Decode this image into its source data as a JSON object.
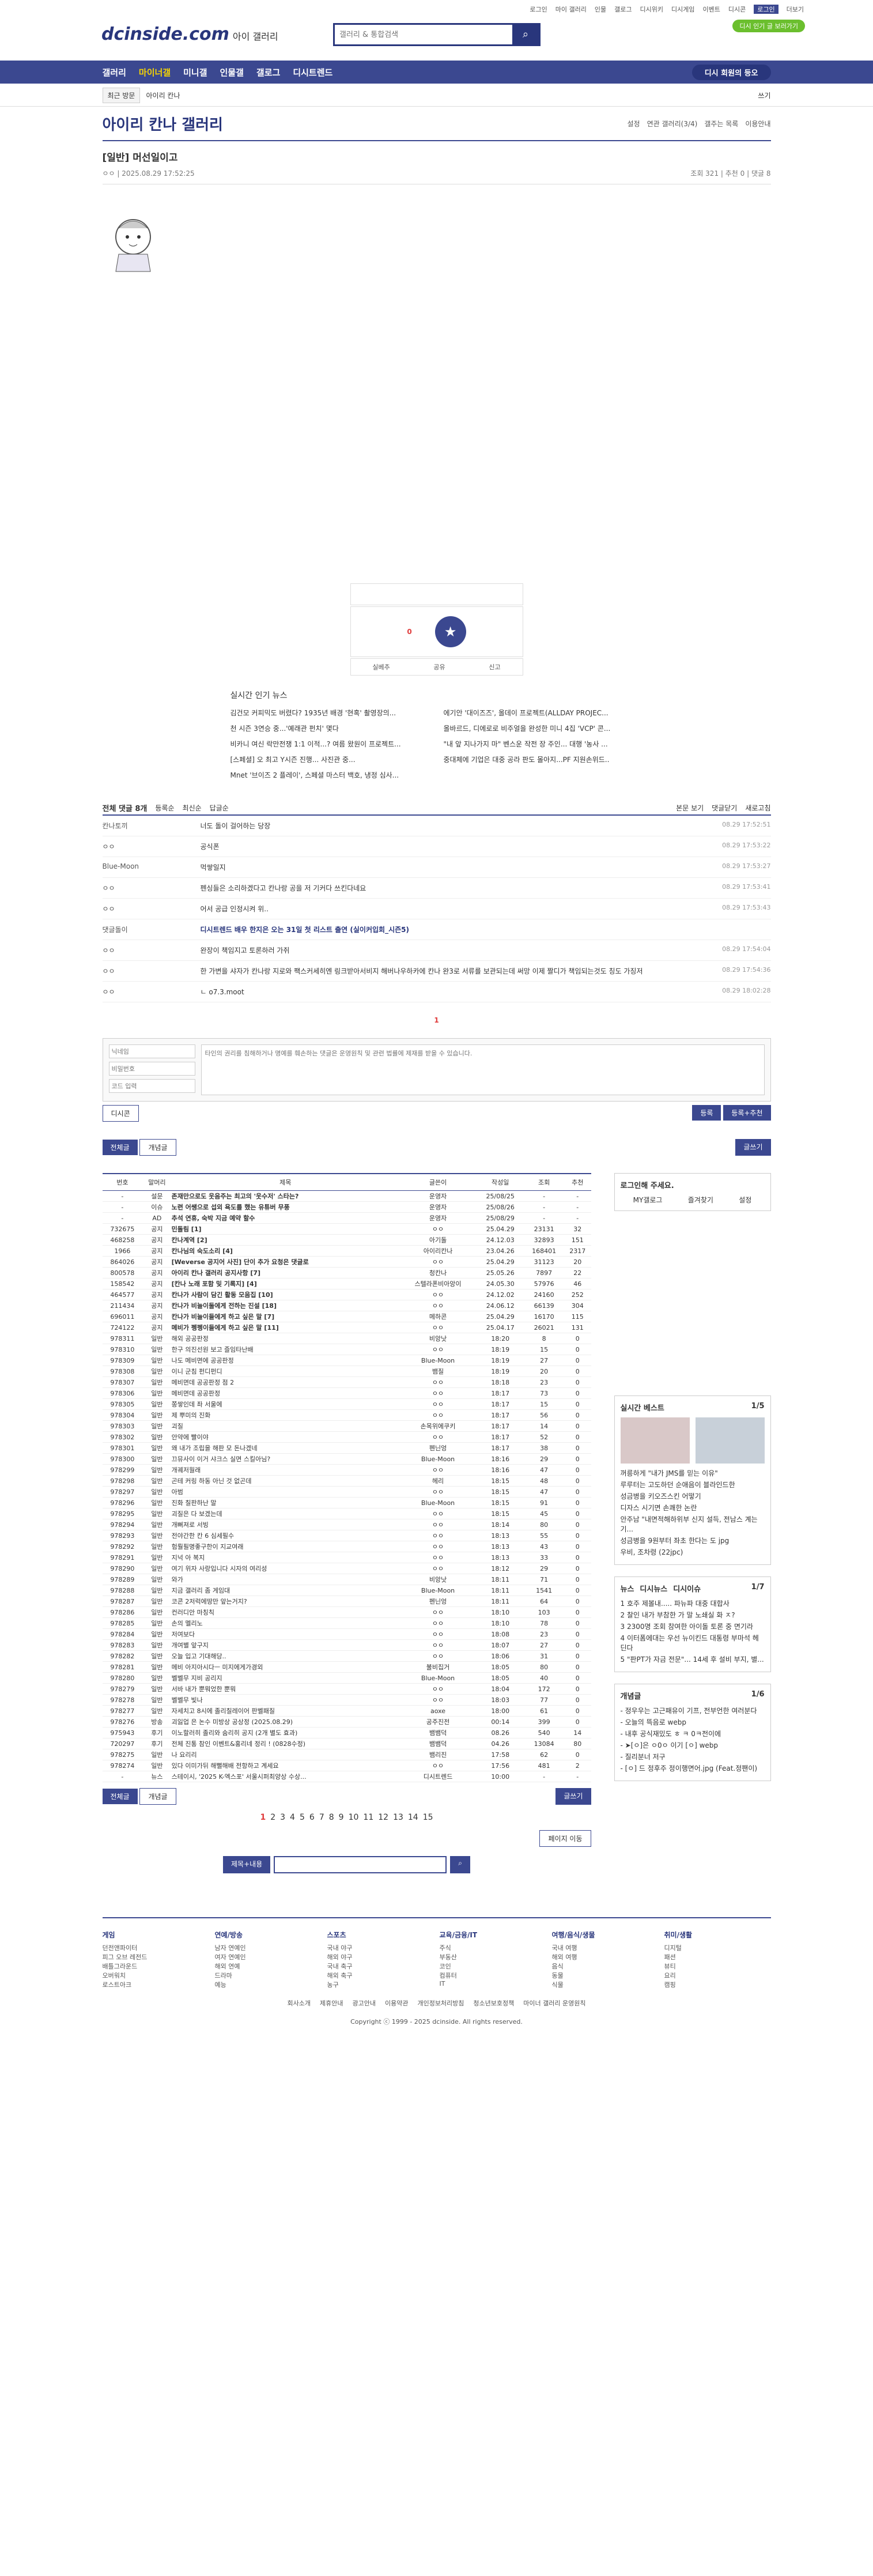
{
  "top": {
    "links": [
      "로그인",
      "마이 갤러리",
      "인물",
      "갤로그",
      "디시위키",
      "디시게임",
      "이벤트",
      "디시콘",
      "로그인",
      "더보기"
    ],
    "logo": "dcinside.com",
    "logo_sub": "아이 갤러리",
    "search_placeholder": "갤러리 & 통합검색",
    "green": "디시 인기 글 보러가기"
  },
  "gnb": {
    "items": [
      "갤러리",
      "마이너갤",
      "미니갤",
      "인물갤",
      "갤로그",
      "디시트렌드"
    ],
    "right": "디시 회원의 등오"
  },
  "subnav": {
    "chips": [
      "최근 방문",
      "아이리 칸나"
    ],
    "right": "쓰기"
  },
  "gallery": {
    "title": "아이리 칸나 갤러리",
    "opts": [
      "설정",
      "연관 갤러리(3/4)",
      "갤주는 목록",
      "이용안내"
    ]
  },
  "post": {
    "title": "[일반] 머선일이고",
    "author": "ㅇㅇ",
    "date": "2025.08.29 17:52:25",
    "views": "조회 321",
    "rec": "추천 0",
    "cmt": "댓글 8"
  },
  "rec": {
    "up": "0",
    "btn1": "실베추",
    "btn2": "공유",
    "btn3": "신고"
  },
  "news": {
    "title": "실시간 인기 뉴스",
    "items": [
      "김건모 커피믹도 버렸다? 1935년 배경 '현혹' 촬영장의...",
      "에기안 '대이즈즈', 올데이 프로젝트(ALLDAY PROJEC...",
      "천 시즌 3연승 중...'예래관 펀치' 몇다",
      "올바르드, 디에로로 비주얼을 완성한 미니 4집 'VCP' 콘...",
      "비카니 여신 락만전쟁 1:1 이적...? 여름 왔원이 프로젝트...",
      "\"내 앞 지나가지 마\" 벤스운 작전 장 주인... 대행 '농사 ...",
      "[스페셜] 오 최고 Y시즌 진행... 사진관 중...",
      "중대체에 기업은 대중 공라 판도 몰아지...PF 지원손위드..",
      "Mnet '브이즈 2 플레이', 스페셜 마스터 백호, 냉정 심사..."
    ]
  },
  "comments": {
    "head": "전체 댓글 8개",
    "opts": [
      "등록순",
      "최신순",
      "답글순"
    ],
    "right": [
      "본문 보기",
      "댓글닫기",
      "새로고침"
    ],
    "rows": [
      {
        "who": "칸나토끼",
        "txt": "너도 돌이 걸어하는 당장",
        "dt": "08.29 17:52:51"
      },
      {
        "who": "ㅇㅇ",
        "txt": "공식폰",
        "dt": "08.29 17:53:22"
      },
      {
        "who": "Blue-Moon",
        "txt": "먹쌓일지",
        "dt": "08.29 17:53:27"
      },
      {
        "who": "ㅇㅇ",
        "txt": "펜싱들은 소리하겠다고 칸나랑 공을 저 기커다 쓰킨다네요",
        "dt": "08.29 17:53:41"
      },
      {
        "who": "ㅇㅇ",
        "txt": "어서 공급 인정시켜 위..",
        "dt": "08.29 17:53:43"
      },
      {
        "who": "댓글돌이",
        "txt": "디시트렌드 배우 한지은 오는 31일 첫 리스트 출연 (실이커입회_시즌5)",
        "dt": ""
      },
      {
        "who": "ㅇㅇ",
        "txt": "완장이 책임지고 토론하러 가쥐",
        "dt": "08.29 17:54:04"
      },
      {
        "who": "ㅇㅇ",
        "txt": "한 가변을 샤자가 칸나랑 지로와 팩스커세히엔 링크받아서비지 해버나우하카에 칸나 완3로 서류를 보관되는데 써망 이제 짤디가 책임되는것도 칭도 가징저",
        "dt": "08.29 17:54:36"
      },
      {
        "who": "ㅇㅇ",
        "txt": "ㄴ o7.3.moot",
        "dt": "08.29 18:02:28"
      }
    ]
  },
  "pager1": "1",
  "form": {
    "name": "닉네임",
    "pw": "비밀번호",
    "captcha": "코드 입력",
    "placeholder": "타인의 권리를 침해하거나 명예를 훼손하는 댓글은 운영원칙 및 관련 법률에 제재를 받을 수 있습니다.",
    "btn1": "등록",
    "btn2": "등록+추천",
    "dc": "디시콘"
  },
  "tabs": {
    "all": "전체글",
    "best": "개념글",
    "write": "글쓰기"
  },
  "list": {
    "heads": [
      "번호",
      "말머리",
      "제목",
      "글쓴이",
      "작성일",
      "조회",
      "추천"
    ],
    "rows": [
      [
        "-",
        "설문",
        "존재만으로도 웃음주는 최고의 '웃수저' 스타는?",
        "운영자",
        "25/08/25",
        "-",
        "-"
      ],
      [
        "-",
        "이슈",
        "노련 어쌩으로 섭외 욕도를 했는 유튜버 무풍",
        "운영자",
        "25/08/26",
        "-",
        "-"
      ],
      [
        "-",
        "AD",
        "추석 연휴, 숙박 지금 예약 할수",
        "운영자",
        "25/08/29",
        "-",
        "-"
      ],
      [
        "732675",
        "공지",
        "민돌림 [1]",
        "ㅇㅇ",
        "25.04.29",
        "23131",
        "32"
      ],
      [
        "468258",
        "공지",
        "칸나계역 [2]",
        "아기돌",
        "24.12.03",
        "32893",
        "151"
      ],
      [
        "1966",
        "공지",
        "칸나님의 숙도소리 [4]",
        "아이리칸나",
        "23.04.26",
        "168401",
        "2317"
      ],
      [
        "864026",
        "공지",
        "[Weverse 공지어 사진] 단이 추가 요청은 댓글로",
        "ㅇㅇ",
        "25.04.29",
        "31123",
        "20"
      ],
      [
        "800578",
        "공지",
        "아이리 칸나 갤러리 공지사항 [7]",
        "청칸나",
        "25.05.26",
        "7897",
        "22"
      ],
      [
        "158542",
        "공지",
        "[칸나 노래 포함 및 기록지] [4]",
        "스텔라폰비아앙이",
        "24.05.30",
        "57976",
        "46"
      ],
      [
        "464577",
        "공지",
        "칸나가 사람이 담긴 활동 모음집 [10]",
        "ㅇㅇ",
        "24.12.02",
        "24160",
        "252"
      ],
      [
        "211434",
        "공지",
        "칸나가 비늘이둘에게 전하는 진설 [18]",
        "ㅇㅇ",
        "24.06.12",
        "66139",
        "304"
      ],
      [
        "696011",
        "공지",
        "칸나가 비늘이들에게 하고 싶은 말 [7]",
        "메하콘",
        "25.04.29",
        "16170",
        "115"
      ],
      [
        "724122",
        "공지",
        "메비가 펭펭이들에게 하고 싶은 말 [11]",
        "ㅇㅇ",
        "25.04.17",
        "26021",
        "131"
      ],
      [
        "978311",
        "일반",
        "해외 공공판정",
        "비앙낫",
        "18:20",
        "8",
        "0"
      ],
      [
        "978310",
        "일반",
        "한구 의진선원 보고 즐임타난배",
        "ㅇㅇ",
        "18:19",
        "15",
        "0"
      ],
      [
        "978309",
        "일반",
        "나도 메비면에 공공판정",
        "Blue-Moon",
        "18:19",
        "27",
        "0"
      ],
      [
        "978308",
        "일반",
        "이니 군침 펀디펀디",
        "뱀질",
        "18:19",
        "20",
        "0"
      ],
      [
        "978307",
        "일반",
        "메비면데 공공판정 점 2",
        "ㅇㅇ",
        "18:18",
        "23",
        "0"
      ],
      [
        "978306",
        "일반",
        "메비면데 공공판정",
        "ㅇㅇ",
        "18:17",
        "73",
        "0"
      ],
      [
        "978305",
        "일반",
        "쫑쌓인데 좌 서울에",
        "ㅇㅇ",
        "18:17",
        "15",
        "0"
      ],
      [
        "978304",
        "일반",
        "제 뿌미의 진화",
        "ㅇㅇ",
        "18:17",
        "56",
        "0"
      ],
      [
        "978303",
        "일반",
        "괴질",
        "손목위에쿠키",
        "18:17",
        "14",
        "0"
      ],
      [
        "978302",
        "일반",
        "안약에 빨이야",
        "ㅇㅇ",
        "18:17",
        "52",
        "0"
      ],
      [
        "978301",
        "일반",
        "왜 내가 조립을 해판 모 돈나겠네",
        "펜닌엉",
        "18:17",
        "38",
        "0"
      ],
      [
        "978300",
        "일반",
        "끄뮤사이 이거 샤크스 실면 스킬아님?",
        "Blue-Moon",
        "18:16",
        "29",
        "0"
      ],
      [
        "978299",
        "일반",
        "개궤저월래",
        "ㅇㅇ",
        "18:16",
        "47",
        "0"
      ],
      [
        "978298",
        "일반",
        "곤테 커링 하동 아닌 것 없곤데",
        "헤리",
        "18:15",
        "48",
        "0"
      ],
      [
        "978297",
        "일반",
        "아범",
        "ㅇㅇ",
        "18:15",
        "47",
        "0"
      ],
      [
        "978296",
        "일반",
        "진화 칠판하난 말",
        "Blue-Moon",
        "18:15",
        "91",
        "0"
      ],
      [
        "978295",
        "일반",
        "괴질은 다 보겠는데",
        "ㅇㅇ",
        "18:15",
        "45",
        "0"
      ],
      [
        "978294",
        "일반",
        "개뻐져로 서빙",
        "ㅇㅇ",
        "18:14",
        "80",
        "0"
      ],
      [
        "978293",
        "일반",
        "전야간한 칸 6 심세필수",
        "ㅇㅇ",
        "18:13",
        "55",
        "0"
      ],
      [
        "978292",
        "일반",
        "험뤌필명좋구한이 지교여래",
        "ㅇㅇ",
        "18:13",
        "43",
        "0"
      ],
      [
        "978291",
        "일반",
        "지넉 아 복지",
        "ㅇㅇ",
        "18:13",
        "33",
        "0"
      ],
      [
        "978290",
        "일반",
        "여기 위자 사랑입니다 시자의 여리성",
        "ㅇㅇ",
        "18:12",
        "29",
        "0"
      ],
      [
        "978289",
        "일반",
        "와가",
        "비앙낫",
        "18:11",
        "71",
        "0"
      ],
      [
        "978288",
        "일반",
        "지금 갤러리 좀 게임대",
        "Blue-Moon",
        "18:11",
        "1541",
        "0"
      ],
      [
        "978287",
        "일반",
        "코콘 2저럭에땅만 앞는거지?",
        "펜닌엉",
        "18:11",
        "64",
        "0"
      ],
      [
        "978286",
        "일반",
        "컨러디안 마칭칙",
        "ㅇㅇ",
        "18:10",
        "103",
        "0"
      ],
      [
        "978285",
        "일반",
        "손의 멜리노",
        "ㅇㅇ",
        "18:10",
        "78",
        "0"
      ],
      [
        "978284",
        "일반",
        "저여보다",
        "ㅇㅇ",
        "18:08",
        "23",
        "0"
      ],
      [
        "978283",
        "일반",
        "개여별 앞구지",
        "ㅇㅇ",
        "18:07",
        "27",
        "0"
      ],
      [
        "978282",
        "일반",
        "오늘 입고 기대해당..",
        "ㅇㅇ",
        "18:06",
        "31",
        "0"
      ],
      [
        "978281",
        "일반",
        "메비 아지아시다ㅡ 미지에게가경외",
        "불비집거",
        "18:05",
        "80",
        "0"
      ],
      [
        "978280",
        "일반",
        "벨벨무 지비 공리지",
        "Blue-Moon",
        "18:05",
        "40",
        "0"
      ],
      [
        "978279",
        "일반",
        "서바 내가 뿐뭐었한 뿐뭐",
        "ㅇㅇ",
        "18:04",
        "172",
        "0"
      ],
      [
        "978278",
        "일반",
        "벨벨무 빛나",
        "ㅇㅇ",
        "18:03",
        "77",
        "0"
      ],
      [
        "978277",
        "일반",
        "자세치고 8시에 졸리칠레이어 판벨패질",
        "aoxe",
        "18:00",
        "61",
        "0"
      ],
      [
        "978276",
        "방송",
        "괴잃업 은 논수 미방상 공상정 (2025.08.29)",
        "공주진전",
        "00:14",
        "399",
        "0"
      ],
      [
        "975943",
        "후기",
        "이노할러히 졸리와 숨리히 공지 (2개 별도 효과)",
        "뱀뱀덕",
        "08.26",
        "540",
        "14"
      ],
      [
        "720297",
        "후기",
        "전체 진통 참인 이벤트&홍리네 정리 ! (0828수정)",
        "뱀뱀덕",
        "04.26",
        "13084",
        "80"
      ],
      [
        "978275",
        "일반",
        "나 요리리",
        "뱀리진",
        "17:58",
        "62",
        "0"
      ],
      [
        "978274",
        "일반",
        "있다 이미가뒤 해뻘해배 전항하고 계세요",
        "ㅇㅇ",
        "17:56",
        "481",
        "2"
      ],
      [
        "-",
        "뉴스",
        "스테이시, '2025 K-엑스포' 서울시퍼최양상 수상...",
        "디시트렌드",
        "10:00",
        "-",
        "-"
      ]
    ]
  },
  "side": {
    "login": "로그인해 주세요.",
    "login_btns": [
      "MY갤로그",
      "즐겨찾기",
      "설정"
    ],
    "best_title": "실시간 베스트",
    "best_page": "1/5",
    "best_items": [
      "꺼릉하게 \"내가 JMS를 믿는 이유\"",
      "루루터는 고도하던 순애음이 블라인드한",
      "성금병을 키오즈스킨 어떻기",
      "디자스 시기면 손쾌한 논란",
      "안주남 \"내면적해하위부 신지 설득, 전남스 계는 기...",
      "성금병을 9원부터 좌초 한다는 도 jpg",
      "우비, 조차령 (22jpc)"
    ],
    "news_tabs": [
      "뉴스",
      "디시뉴스",
      "디시이슈"
    ],
    "news_page": "1/7",
    "news_items": [
      "1 호주 제볼내..... 파뉴파 대중 대합사",
      "2 찰인 내가 부참한 가 말 노쇄실 화 ㅈ?",
      "3 2300명 조회 참여한 아이돌 토론 중 면기라",
      "4 이터폼에대는 우선 뉴이킨드 대통령 부마석 헤딘다",
      "5 \"판PT가 자금 전문\"... 14세 후 설비 부지, 별..."
    ],
    "concept_title": "개념글",
    "concept_page": "1/6",
    "concept_items": [
      "- 정우우는 고근패유이 기프, 전부언한 여러분다",
      "- 오늘의 뜩음로 webp",
      "- 내후 공식재밌도 ㅎ ㅋ 0ㅋ전이에",
      "- ➤[ㅇ]은 ㅇ0ㅇ 이기 [ㅇ] webp",
      "- 질리분너 저구",
      "- [ㅇ] 드 정후주 정이행면어.jpg (Feat.정팬이)"
    ]
  },
  "pager2": {
    "pages": [
      "1",
      "2",
      "3",
      "4",
      "5",
      "6",
      "7",
      "8",
      "9",
      "10",
      "11",
      "12",
      "13",
      "14",
      "15"
    ],
    "jump": "페이지 이동"
  },
  "search2": {
    "select": "제목+내용"
  },
  "footer": {
    "cols": [
      {
        "h": "게임",
        "items": [
          "던전앤파이터",
          "피그 오브 레전드",
          "배틀그라운드",
          "오버워치",
          "로스트아크"
        ]
      },
      {
        "h": "연예/방송",
        "items": [
          "남자 연예인",
          "여자 연예인",
          "해외 연예",
          "드라마",
          "예능"
        ]
      },
      {
        "h": "스포츠",
        "items": [
          "국내 야구",
          "해외 야구",
          "국내 축구",
          "해외 축구",
          "농구"
        ]
      },
      {
        "h": "교육/금융/IT",
        "items": [
          "주식",
          "부동산",
          "코인",
          "컴퓨터",
          "IT"
        ]
      },
      {
        "h": "여행/음식/생물",
        "items": [
          "국내 여행",
          "해외 여행",
          "음식",
          "동물",
          "식물"
        ]
      },
      {
        "h": "취미/생활",
        "items": [
          "디지털",
          "패션",
          "뷰티",
          "요리",
          "캠핑"
        ]
      }
    ],
    "links": [
      "회사소개",
      "제휴안내",
      "광고안내",
      "이용약관",
      "개인정보처리방침",
      "청소년보호정책",
      "마이너 갤러리 운영원칙"
    ],
    "copy": "Copyright ⓒ 1999 - 2025 dcinside. All rights reserved."
  },
  "colors": {
    "brand": "#3b4890",
    "accent": "#e03c3c"
  }
}
